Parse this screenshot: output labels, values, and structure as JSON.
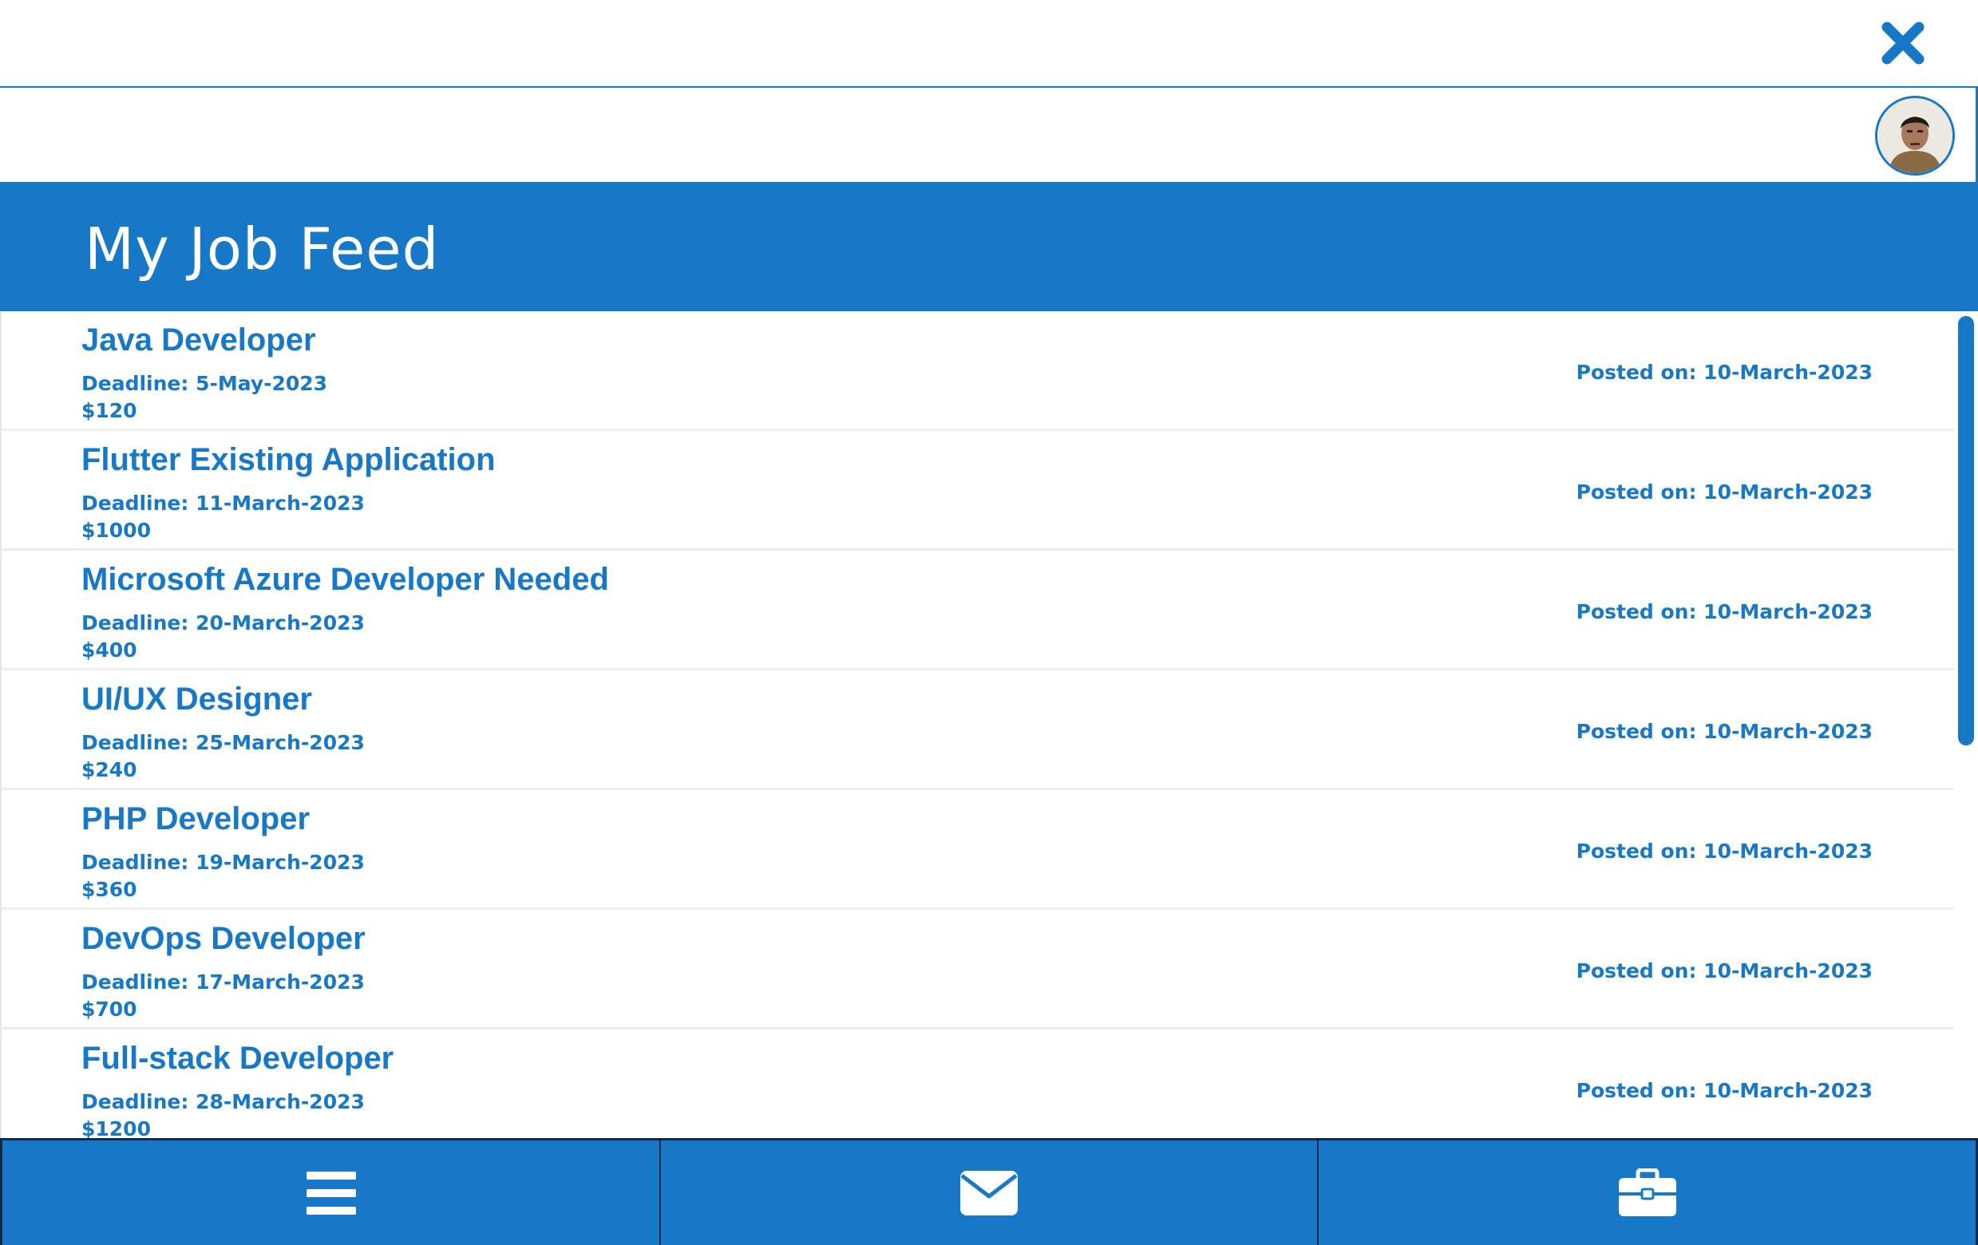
{
  "header": {
    "title": "My Job Feed"
  },
  "jobs": [
    {
      "title": "Java Developer",
      "deadline": "Deadline: 5-May-2023",
      "price": "$120",
      "posted": "Posted on: 10-March-2023"
    },
    {
      "title": "Flutter Existing Application",
      "deadline": "Deadline: 11-March-2023",
      "price": "$1000",
      "posted": "Posted on: 10-March-2023"
    },
    {
      "title": "Microsoft Azure Developer Needed",
      "deadline": "Deadline: 20-March-2023",
      "price": "$400",
      "posted": "Posted on: 10-March-2023"
    },
    {
      "title": "UI/UX Designer",
      "deadline": "Deadline: 25-March-2023",
      "price": "$240",
      "posted": "Posted on: 10-March-2023"
    },
    {
      "title": "PHP Developer",
      "deadline": "Deadline: 19-March-2023",
      "price": "$360",
      "posted": "Posted on: 10-March-2023"
    },
    {
      "title": "DevOps Developer",
      "deadline": "Deadline: 17-March-2023",
      "price": "$700",
      "posted": "Posted on: 10-March-2023"
    },
    {
      "title": "Full-stack Developer",
      "deadline": "Deadline: 28-March-2023",
      "price": "$1200",
      "posted": "Posted on: 10-March-2023"
    }
  ],
  "icons": {
    "close": "close-icon",
    "avatar": "user-avatar",
    "nav": [
      "menu-icon",
      "mail-icon",
      "briefcase-icon"
    ]
  },
  "colors": {
    "accent": "#1878c8",
    "nav_border": "#0e2a44",
    "background": "#ffffff"
  }
}
